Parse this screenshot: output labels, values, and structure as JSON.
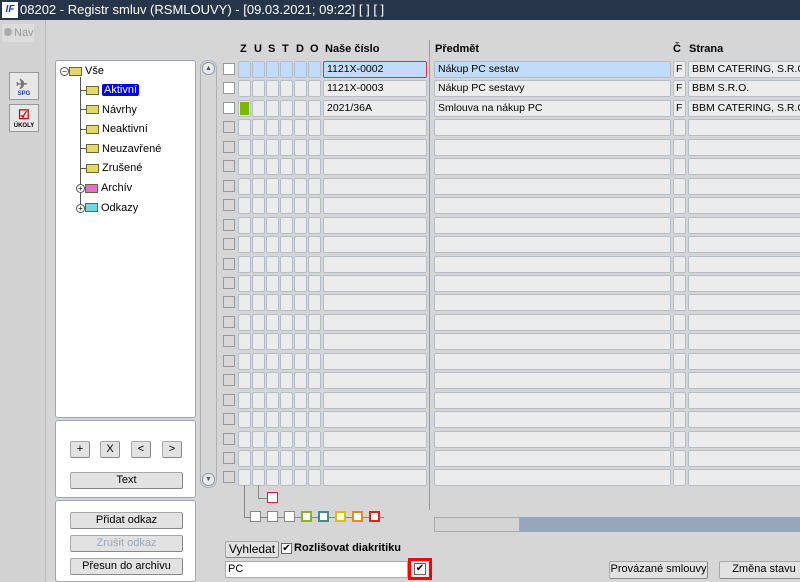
{
  "window": {
    "title": "08202 - Registr smluv (RSMLOUVY) - [09.03.2021; 09:22]  [ ]  [ ]",
    "logo": "IF"
  },
  "left_strip": {
    "nav_label": "Nav",
    "buttons": [
      {
        "label": "SPG",
        "icon": "paper-plane-icon"
      },
      {
        "label": "ÚKOLY",
        "icon": "task-list-icon"
      }
    ]
  },
  "tree": {
    "root": "Vše",
    "items": [
      {
        "label": "Aktivní",
        "selected": true,
        "color": "#e3d96a"
      },
      {
        "label": "Návrhy",
        "color": "#e3d96a"
      },
      {
        "label": "Neaktivní",
        "color": "#e3d96a"
      },
      {
        "label": "Neuzavřené",
        "color": "#e3d96a"
      },
      {
        "label": "Zrušené",
        "color": "#e3d96a"
      },
      {
        "label": "Archív",
        "expandable": true,
        "color": "#e070d0"
      },
      {
        "label": "Odkazy",
        "expandable": true,
        "color": "#70d8e0"
      }
    ]
  },
  "tree_controls": {
    "plus": "+",
    "delete": "X",
    "prev": "<",
    "next": ">",
    "text": "Text"
  },
  "link_actions": {
    "add": "Přidat odkaz",
    "remove": "Zrušit odkaz",
    "archive": "Přesun do archivu"
  },
  "grid": {
    "headers": {
      "z": "Z",
      "u": "U",
      "s": "S",
      "t": "T",
      "d": "D",
      "o": "O",
      "number": "Naše číslo",
      "subject": "Předmět",
      "c": "Č",
      "party": "Strana"
    },
    "rows": [
      {
        "number": "1121X-0002",
        "subject": "Nákup PC sestav",
        "c": "F",
        "party": "BBM CATERING, S.R.O. U",
        "selected": true,
        "z_status": ""
      },
      {
        "number": "1121X-0003",
        "subject": "Nákup PC sestavy",
        "c": "F",
        "party": "BBM S.R.O.",
        "z_status": ""
      },
      {
        "number": "2021/36A",
        "subject": "Smlouva na nákup PC",
        "c": "F",
        "party": "BBM CATERING, S.R.O. U",
        "z_status": "#7ab800"
      }
    ]
  },
  "legend_colors": [
    "#888888",
    "#888888",
    "#888888",
    "#8ab030",
    "#4a8a88",
    "#e0c000",
    "#e08a20",
    "#e02020"
  ],
  "legend_top_color": "#e02020",
  "search": {
    "button": "Vyhledat",
    "diacritics_label": "Rozlišovat diakritiku",
    "diacritics_checked": true,
    "value": "PC",
    "confirm_checked": true
  },
  "bottom_buttons": {
    "linked": "Provázané smlouvy",
    "change_state": "Změna stavu"
  }
}
